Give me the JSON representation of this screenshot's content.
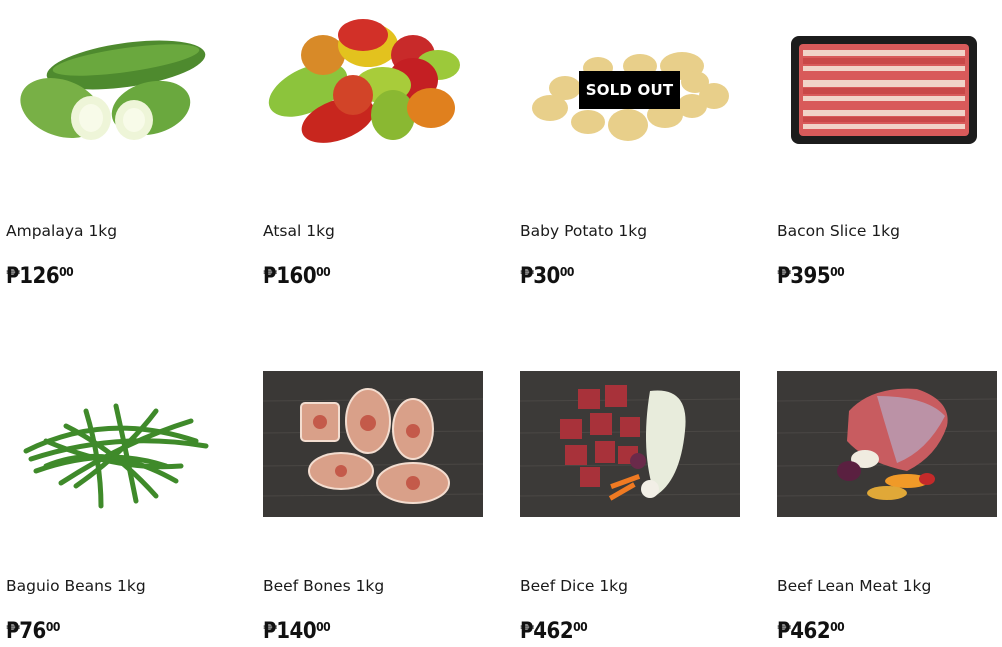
{
  "products": [
    {
      "name": "Ampalaya 1kg",
      "currency": "₱",
      "whole": "126",
      "cents": "00",
      "image": "ampalaya-image"
    },
    {
      "name": "Atsal 1kg",
      "currency": "₱",
      "whole": "160",
      "cents": "00",
      "image": "bell-pepper-image"
    },
    {
      "name": "Baby Potato 1kg",
      "currency": "₱",
      "whole": "30",
      "cents": "00",
      "image": "potato-image",
      "badge": "SOLD OUT"
    },
    {
      "name": "Bacon Slice 1kg",
      "currency": "₱",
      "whole": "395",
      "cents": "00",
      "image": "bacon-image"
    },
    {
      "name": "Baguio Beans 1kg",
      "currency": "₱",
      "whole": "76",
      "cents": "00",
      "image": "green-beans-image"
    },
    {
      "name": "Beef Bones 1kg",
      "currency": "₱",
      "whole": "140",
      "cents": "00",
      "image": "beef-bones-image"
    },
    {
      "name": "Beef Dice 1kg",
      "currency": "₱",
      "whole": "462",
      "cents": "00",
      "image": "beef-dice-image"
    },
    {
      "name": "Beef Lean Meat 1kg",
      "currency": "₱",
      "whole": "462",
      "cents": "00",
      "image": "beef-lean-meat-image"
    }
  ]
}
